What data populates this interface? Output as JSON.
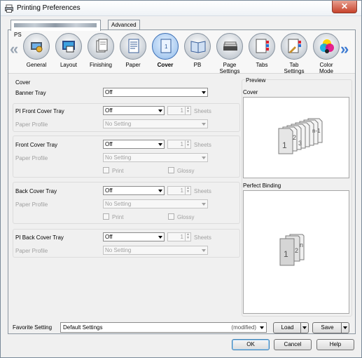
{
  "window": {
    "title": "Printing Preferences",
    "close_label": "✕"
  },
  "tabs": {
    "main_suffix": "PS",
    "advanced": "Advanced"
  },
  "nav": {
    "items": [
      {
        "label": "General",
        "icon": "general-icon"
      },
      {
        "label": "Layout",
        "icon": "layout-icon"
      },
      {
        "label": "Finishing",
        "icon": "finishing-icon"
      },
      {
        "label": "Paper",
        "icon": "paper-icon"
      },
      {
        "label": "Cover",
        "icon": "cover-icon",
        "active": true
      },
      {
        "label": "PB",
        "icon": "pb-icon"
      },
      {
        "label": "Page Settings",
        "icon": "page-settings-icon"
      },
      {
        "label": "Tabs",
        "icon": "tabs-icon"
      },
      {
        "label": "Tab Settings",
        "icon": "tab-settings-icon"
      },
      {
        "label": "Color Mode",
        "label2": "Mode",
        "label1": "Color",
        "icon": "color-mode-icon"
      }
    ],
    "prev_arrow": "«",
    "next_arrow": "»"
  },
  "cover": {
    "title": "Cover",
    "banner_tray_label": "Banner Tray",
    "banner_tray_value": "Off",
    "pi_front": {
      "label": "PI Front Cover Tray",
      "value": "Off",
      "count": "1",
      "sheets": "Sheets",
      "paper_profile_label": "Paper Profile",
      "paper_profile_value": "No Setting"
    },
    "front": {
      "label": "Front Cover Tray",
      "value": "Off",
      "count": "1",
      "sheets": "Sheets",
      "paper_profile_label": "Paper Profile",
      "paper_profile_value": "No Setting",
      "print_label": "Print",
      "glossy_label": "Glossy"
    },
    "back": {
      "label": "Back Cover Tray",
      "value": "Off",
      "count": "1",
      "sheets": "Sheets",
      "paper_profile_label": "Paper Profile",
      "paper_profile_value": "No Setting",
      "print_label": "Print",
      "glossy_label": "Glossy"
    },
    "pi_back": {
      "label": "PI Back Cover Tray",
      "value": "Off",
      "count": "1",
      "sheets": "Sheets",
      "paper_profile_label": "Paper Profile",
      "paper_profile_value": "No Setting"
    }
  },
  "preview": {
    "title": "Preview",
    "cover_label": "Cover",
    "cover_page_labels": {
      "first": "1",
      "second": "2",
      "third": "3",
      "last": "n-1"
    },
    "perfect_binding_label": "Perfect Binding",
    "pb_page_labels": {
      "first": "1",
      "second": "2",
      "last": "n"
    }
  },
  "favorite": {
    "label": "Favorite Setting",
    "value": "Default Settings",
    "modified": "(modified)",
    "load": "Load",
    "save": "Save"
  },
  "buttons": {
    "ok": "OK",
    "cancel": "Cancel",
    "help": "Help"
  }
}
